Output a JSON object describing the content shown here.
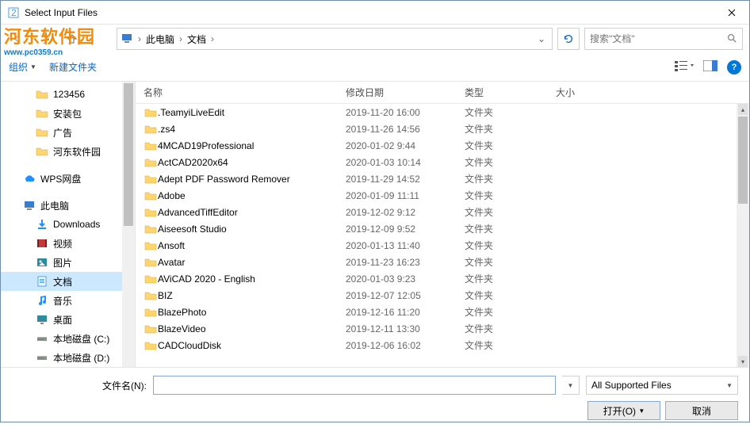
{
  "titlebar": {
    "title": "Select Input Files"
  },
  "breadcrumb": {
    "part1": "此电脑",
    "part2": "文档"
  },
  "search": {
    "placeholder": "搜索\"文档\""
  },
  "toolbar": {
    "organize": "组织",
    "newfolder": "新建文件夹"
  },
  "columns": {
    "name": "名称",
    "date": "修改日期",
    "type": "类型",
    "size": "大小"
  },
  "sidebar": {
    "items": [
      {
        "label": "123456",
        "indent": true,
        "icon": "folder"
      },
      {
        "label": "安装包",
        "indent": true,
        "icon": "folder"
      },
      {
        "label": "广告",
        "indent": true,
        "icon": "folder"
      },
      {
        "label": "河东软件园",
        "indent": true,
        "icon": "folder"
      },
      {
        "label": "WPS网盘",
        "indent": false,
        "icon": "cloud"
      },
      {
        "label": "此电脑",
        "indent": false,
        "icon": "pc"
      },
      {
        "label": "Downloads",
        "indent": true,
        "icon": "download"
      },
      {
        "label": "视频",
        "indent": true,
        "icon": "video"
      },
      {
        "label": "图片",
        "indent": true,
        "icon": "picture"
      },
      {
        "label": "文档",
        "indent": true,
        "icon": "doc",
        "sel": true
      },
      {
        "label": "音乐",
        "indent": true,
        "icon": "music"
      },
      {
        "label": "桌面",
        "indent": true,
        "icon": "desktop"
      },
      {
        "label": "本地磁盘 (C:)",
        "indent": true,
        "icon": "drive"
      },
      {
        "label": "本地磁盘 (D:)",
        "indent": true,
        "icon": "drive"
      }
    ]
  },
  "files": [
    {
      "name": ".TeamyiLiveEdit",
      "date": "2019-11-20 16:00",
      "type": "文件夹"
    },
    {
      "name": ".zs4",
      "date": "2019-11-26 14:56",
      "type": "文件夹"
    },
    {
      "name": "4MCAD19Professional",
      "date": "2020-01-02 9:44",
      "type": "文件夹"
    },
    {
      "name": "ActCAD2020x64",
      "date": "2020-01-03 10:14",
      "type": "文件夹"
    },
    {
      "name": "Adept PDF Password Remover",
      "date": "2019-11-29 14:52",
      "type": "文件夹"
    },
    {
      "name": "Adobe",
      "date": "2020-01-09 11:11",
      "type": "文件夹"
    },
    {
      "name": "AdvancedTiffEditor",
      "date": "2019-12-02 9:12",
      "type": "文件夹"
    },
    {
      "name": "Aiseesoft Studio",
      "date": "2019-12-09 9:52",
      "type": "文件夹"
    },
    {
      "name": "Ansoft",
      "date": "2020-01-13 11:40",
      "type": "文件夹"
    },
    {
      "name": "Avatar",
      "date": "2019-11-23 16:23",
      "type": "文件夹"
    },
    {
      "name": "AViCAD 2020 - English",
      "date": "2020-01-03 9:23",
      "type": "文件夹"
    },
    {
      "name": "BIZ",
      "date": "2019-12-07 12:05",
      "type": "文件夹"
    },
    {
      "name": "BlazePhoto",
      "date": "2019-12-16 11:20",
      "type": "文件夹"
    },
    {
      "name": "BlazeVideo",
      "date": "2019-12-11 13:30",
      "type": "文件夹"
    },
    {
      "name": "CADCloudDisk",
      "date": "2019-12-06 16:02",
      "type": "文件夹"
    }
  ],
  "bottom": {
    "filename_label": "文件名(N):",
    "filter": "All Supported Files",
    "open": "打开(O)",
    "cancel": "取消"
  }
}
